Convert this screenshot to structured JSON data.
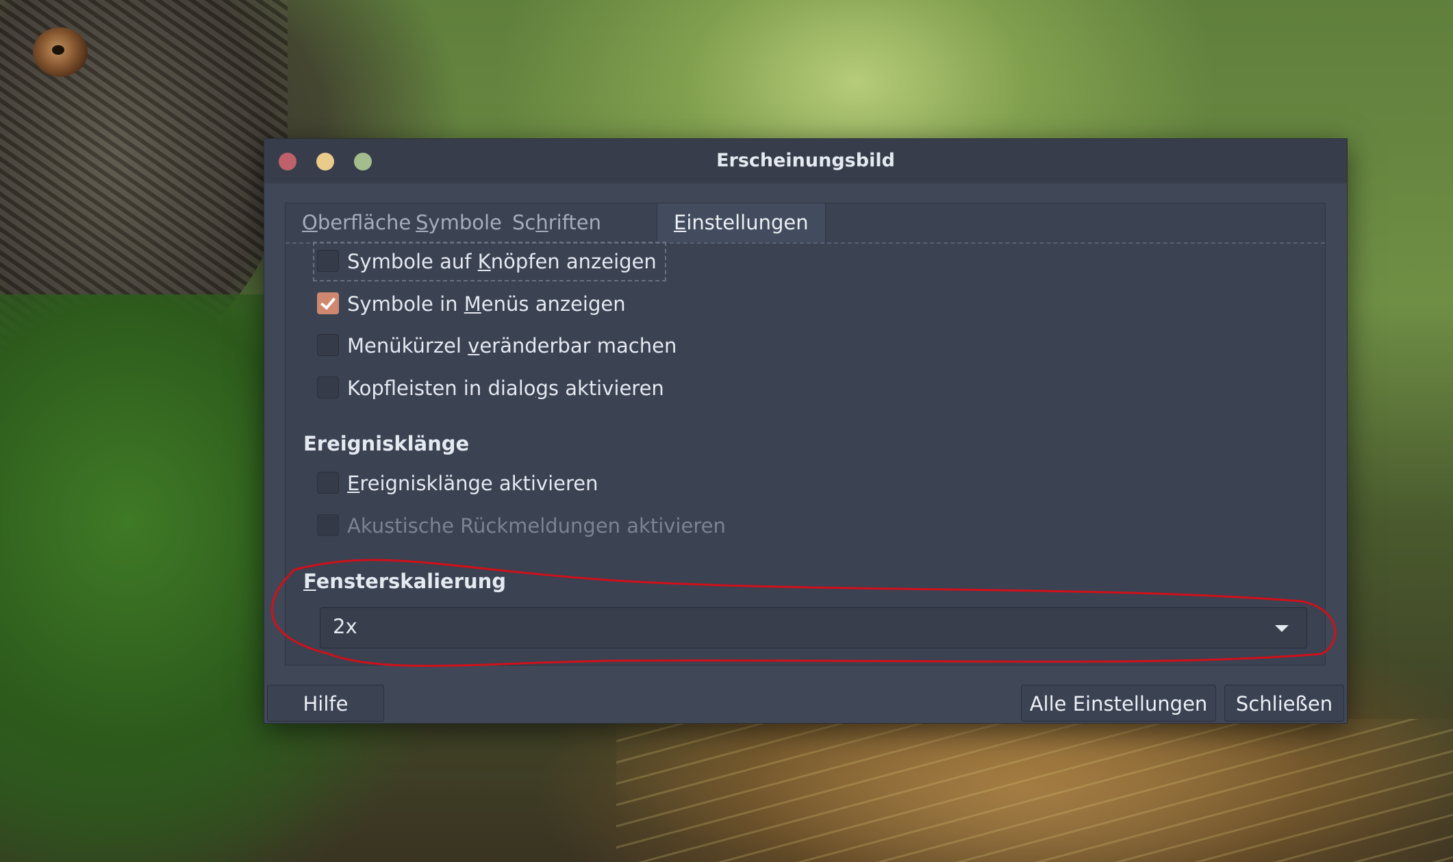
{
  "window": {
    "title": "Erscheinungsbild",
    "controls": [
      "close",
      "minimize",
      "maximize"
    ]
  },
  "tabs": [
    {
      "pre": "",
      "key": "O",
      "post": "berfläche"
    },
    {
      "pre": "",
      "key": "S",
      "post": "ymbole"
    },
    {
      "pre": "Sc",
      "key": "h",
      "post": "riften"
    },
    {
      "pre": "",
      "key": "E",
      "post": "instellungen"
    }
  ],
  "active_tab": "Einstellungen",
  "options": [
    {
      "pre": "Symbole auf ",
      "key": "K",
      "post": "nöpfen anzeigen",
      "checked": false
    },
    {
      "pre": "Symbole in ",
      "key": "M",
      "post": "enüs anzeigen",
      "checked": true
    },
    {
      "pre": "Menükürzel ",
      "key": "v",
      "post": "eränderbar machen",
      "checked": false
    },
    {
      "pre": "Kopfleisten in dialo",
      "key": "g",
      "post": "s aktivieren",
      "checked": false
    }
  ],
  "sound_section": {
    "heading": "Ereignisklänge",
    "options": [
      {
        "pre": "",
        "key": "E",
        "post": "reignisklänge aktivieren",
        "checked": false,
        "disabled": false
      },
      {
        "pre": "Akustische Rückmeldungen aktivieren",
        "key": "",
        "post": "",
        "checked": false,
        "disabled": true
      }
    ]
  },
  "scaling_section": {
    "heading_key": "F",
    "heading_rest": "ensterskalierung",
    "selected": "2x"
  },
  "buttons": {
    "help": "Hilfe",
    "all_settings": "Alle Einstellungen",
    "close": "Schließen"
  },
  "colors": {
    "accent": "#d08770",
    "annotation": "#d0101a"
  }
}
